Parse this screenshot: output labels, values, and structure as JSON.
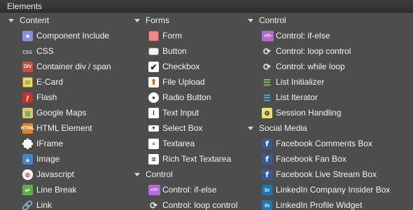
{
  "panel": {
    "title": "Elements"
  },
  "columns": [
    {
      "groups": [
        {
          "label": "Content",
          "items": [
            {
              "label": "Component Include",
              "icon": "puzzle-icon",
              "glyph": "✦",
              "cls": "ic-puzzle"
            },
            {
              "label": "CSS",
              "icon": "css-icon",
              "glyph": "css",
              "cls": "ic-css"
            },
            {
              "label": "Container div / span",
              "icon": "div-icon",
              "glyph": "DIV",
              "cls": "ic-red"
            },
            {
              "label": "E-Card",
              "icon": "ecard-icon",
              "glyph": "✉",
              "cls": "ic-ecard"
            },
            {
              "label": "Flash",
              "icon": "flash-icon",
              "glyph": "ƒ",
              "cls": "ic-flash"
            },
            {
              "label": "Google Maps",
              "icon": "map-icon",
              "glyph": "▦",
              "cls": "ic-map"
            },
            {
              "label": "HTML Element",
              "icon": "html-icon",
              "glyph": "HTML",
              "cls": "ic-orange"
            },
            {
              "label": "IFrame",
              "icon": "iframe-icon",
              "glyph": "",
              "cls": "ic-iframe"
            },
            {
              "label": "Image",
              "icon": "image-icon",
              "glyph": "▲",
              "cls": "ic-image"
            },
            {
              "label": "Javascript",
              "icon": "javascript-icon",
              "glyph": "⊘",
              "cls": "ic-js"
            },
            {
              "label": "Line Break",
              "icon": "line-break-icon",
              "glyph": "↵",
              "cls": "ic-green"
            },
            {
              "label": "Link",
              "icon": "link-icon",
              "glyph": "🔗",
              "cls": "ic-link"
            }
          ]
        }
      ]
    },
    {
      "groups": [
        {
          "label": "Forms",
          "items": [
            {
              "label": "Form",
              "icon": "form-icon",
              "glyph": "",
              "cls": "ic-form"
            },
            {
              "label": "Button",
              "icon": "button-icon",
              "glyph": "",
              "cls": "ic-button"
            },
            {
              "label": "Checkbox",
              "icon": "checkbox-icon",
              "glyph": "✔",
              "cls": "ic-check"
            },
            {
              "label": "File Upload",
              "icon": "upload-icon",
              "glyph": "⬆",
              "cls": "ic-upload"
            },
            {
              "label": "Radio Button",
              "icon": "radio-icon",
              "glyph": "●",
              "cls": "ic-radio"
            },
            {
              "label": "Text Input",
              "icon": "text-input-icon",
              "glyph": "I",
              "cls": "ic-text"
            },
            {
              "label": "Select Box",
              "icon": "select-icon",
              "glyph": "▾",
              "cls": "ic-select"
            },
            {
              "label": "Textarea",
              "icon": "textarea-icon",
              "glyph": "≡",
              "cls": "ic-textarea"
            },
            {
              "label": "Rich Text Textarea",
              "icon": "rich-textarea-icon",
              "glyph": "≣",
              "cls": "ic-textarea"
            }
          ]
        },
        {
          "label": "Control",
          "items": [
            {
              "label": "Control: if-else",
              "icon": "if-else-icon",
              "glyph": "&lt;if&gt;",
              "cls": "ic-if"
            },
            {
              "label": "Control: loop control",
              "icon": "loop-icon",
              "glyph": "⟳",
              "cls": "ic-loop"
            }
          ]
        }
      ]
    },
    {
      "groups": [
        {
          "label": "Control",
          "items": [
            {
              "label": "Control: if-else",
              "icon": "if-else-icon",
              "glyph": "&lt;if&gt;",
              "cls": "ic-if"
            },
            {
              "label": "Control: loop control",
              "icon": "loop-icon",
              "glyph": "⟳",
              "cls": "ic-loop"
            },
            {
              "label": "Control: while loop",
              "icon": "while-loop-icon",
              "glyph": "⟳",
              "cls": "ic-loop"
            },
            {
              "label": "List Initializer",
              "icon": "list-initializer-icon",
              "glyph": "☰",
              "cls": "ic-list"
            },
            {
              "label": "List Iterator",
              "icon": "list-iterator-icon",
              "glyph": "☰",
              "cls": "ic-listit"
            },
            {
              "label": "Session Handling",
              "icon": "session-icon",
              "glyph": "⚙",
              "cls": "ic-session"
            }
          ]
        },
        {
          "label": "Social Media",
          "items": [
            {
              "label": "Facebook Comments Box",
              "icon": "facebook-icon",
              "glyph": "f",
              "cls": "ic-fb"
            },
            {
              "label": "Facebook Fan Box",
              "icon": "facebook-icon",
              "glyph": "f",
              "cls": "ic-fb"
            },
            {
              "label": "Facebook Live Stream Box",
              "icon": "facebook-icon",
              "glyph": "f",
              "cls": "ic-fb"
            },
            {
              "label": "LinkedIn Company Insider Box",
              "icon": "linkedin-icon",
              "glyph": "in",
              "cls": "ic-in"
            },
            {
              "label": "LinkedIn Profile Widget",
              "icon": "linkedin-icon",
              "glyph": "in",
              "cls": "ic-in"
            }
          ]
        }
      ]
    }
  ]
}
